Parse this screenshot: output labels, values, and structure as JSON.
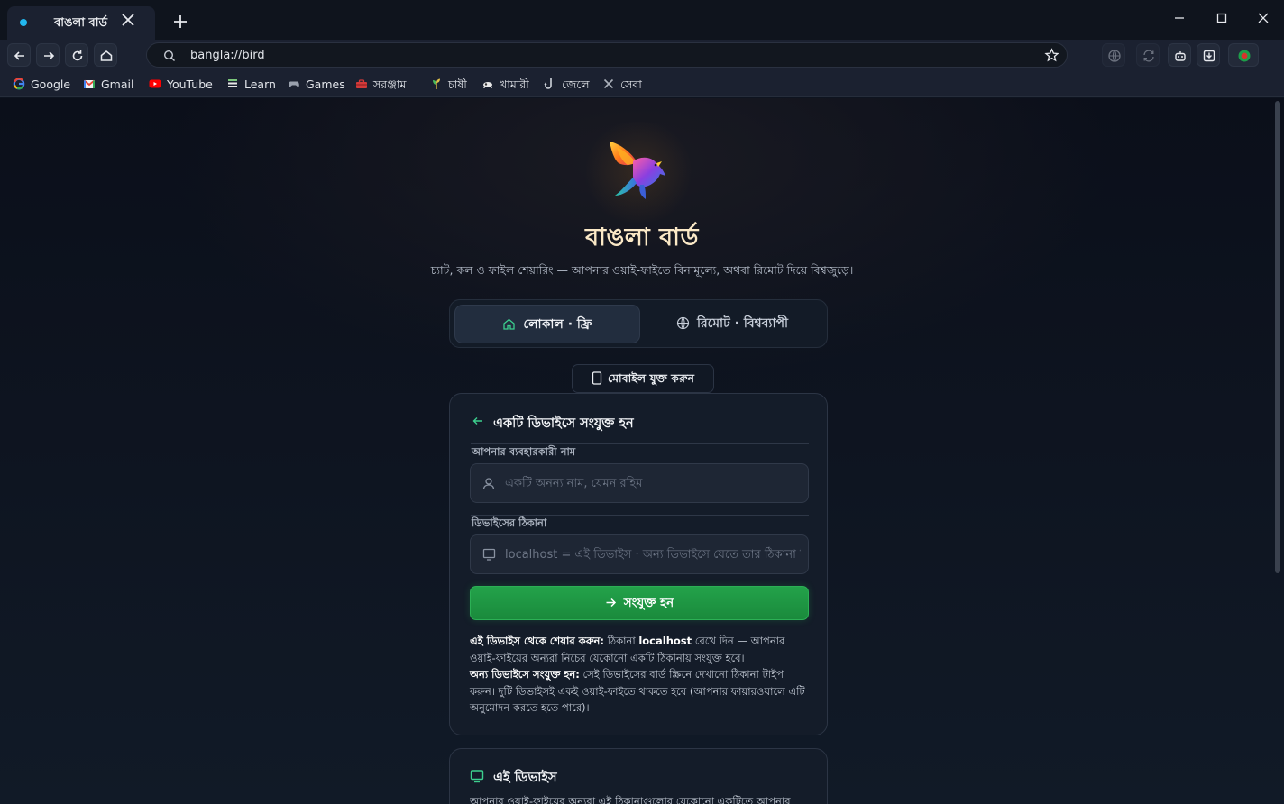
{
  "browser": {
    "tab_title": "বাঙলা বার্ড",
    "url": "bangla://bird",
    "bookmarks": [
      {
        "label": "Google",
        "icon": "google-icon"
      },
      {
        "label": "Gmail",
        "icon": "gmail-icon"
      },
      {
        "label": "YouTube",
        "icon": "youtube-icon"
      },
      {
        "label": "Learn",
        "icon": "learn-icon"
      },
      {
        "label": "Games",
        "icon": "gamepad-icon"
      },
      {
        "label": "সরঞ্জাম",
        "icon": "toolbox-icon"
      },
      {
        "label": "চাষী",
        "icon": "plant-icon"
      },
      {
        "label": "খামারী",
        "icon": "cow-icon"
      },
      {
        "label": "জেলে",
        "icon": "fishing-hook-icon"
      },
      {
        "label": "সেবা",
        "icon": "tools-icon"
      }
    ]
  },
  "app": {
    "title": "বাঙলা বার্ড",
    "subtitle": "চ্যাট, কল ও ফাইল শেয়ারিং — আপনার ওয়াই-ফাইতে বিনামূল্যে, অথবা রিমোট দিয়ে বিশ্বজুড়ে।",
    "modes": {
      "local": "লোকাল · ফ্রি",
      "remote": "রিমোট · বিশ্বব্যাপী"
    },
    "mobile_button": "মোবাইল যুক্ত করুন"
  },
  "connect_card": {
    "title": "একটি ডিভাইসে সংযুক্ত হন",
    "username_label": "আপনার ব্যবহারকারী নাম",
    "username_placeholder": "একটি অনন্য নাম, যেমন রহিম",
    "address_label": "ডিভাইসের ঠিকানা",
    "address_placeholder": "localhost = এই ডিভাইস · অন্য ডিভাইসে যেতে তার ঠিকানা দিন",
    "connect_button": "সংযুক্ত হন",
    "help": {
      "share_title": "এই ডিভাইস থেকে শেয়ার করুন:",
      "share_pre": " ঠিকানা ",
      "share_keyword": "localhost",
      "share_post": " রেখে দিন — আপনার ওয়াই-ফাইয়ের অন্যরা নিচের যেকোনো একটি ঠিকানায় সংযুক্ত হবে।",
      "other_title": "অন্য ডিভাইসে সংযুক্ত হন:",
      "other_text": " সেই ডিভাইসের বার্ড স্ক্রিনে দেখানো ঠিকানা টাইপ করুন। দুটি ডিভাইসই একই ওয়াই-ফাইতে থাকতে হবে (আপনার ফায়ারওয়ালে এটি অনুমোদন করতে হতে পারে)।"
    }
  },
  "device_card": {
    "title": "এই ডিভাইস",
    "description": "আপনার ওয়াই-ফাইয়ের অন্যরা এই ঠিকানাগুলোর যেকোনো একটিতে আপনার"
  },
  "colors": {
    "accent_green": "#1f9b45",
    "page_bg": "#0e1420",
    "title_gold": "#fbe9c7"
  }
}
